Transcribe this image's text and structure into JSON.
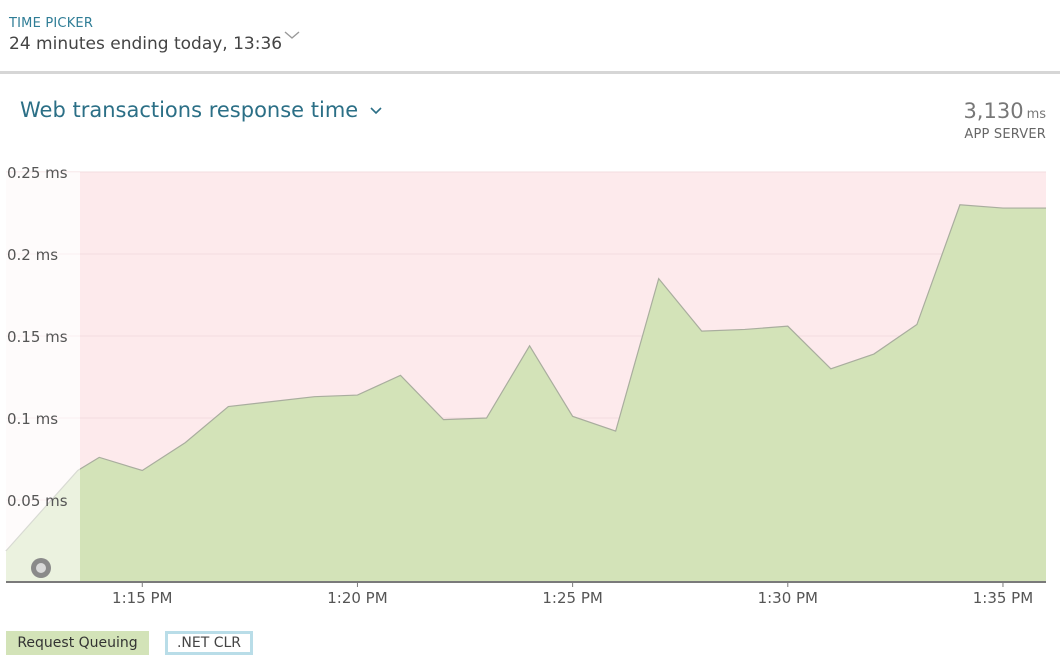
{
  "time_picker": {
    "label": "TIME PICKER",
    "value": "24 minutes ending today, 13:36",
    "chevron_icon": "chevron-down-icon"
  },
  "panel": {
    "title": "Web transactions response time",
    "title_chevron_icon": "chevron-down-icon",
    "metric_value": "3,130",
    "metric_unit": "ms",
    "metric_label": "APP SERVER"
  },
  "colors": {
    "series_fill": "#d3e3b8",
    "series_stroke": "#a9ad9e",
    "threshold_band": "#fdeaec",
    "axis": "#7a7a7a",
    "accent": "#2b6f86"
  },
  "chart_data": {
    "type": "area",
    "title": "Web transactions response time",
    "ylabel": "",
    "xlabel": "",
    "ylim": [
      0,
      0.25
    ],
    "y_ticks": [
      "0.25 ms",
      "0.2 ms",
      "0.15 ms",
      "0.1 ms",
      "0.05 ms"
    ],
    "y_tick_values": [
      0.25,
      0.2,
      0.15,
      0.1,
      0.05
    ],
    "xlim": [
      "13:11:50",
      "13:36:00"
    ],
    "x_ticks": [
      "1:15 PM",
      "1:20 PM",
      "1:25 PM",
      "1:30 PM",
      "1:35 PM"
    ],
    "x_tick_times": [
      "13:15:00",
      "13:20:00",
      "13:25:00",
      "13:30:00",
      "13:35:00"
    ],
    "grid": true,
    "legend_position": "bottom-left",
    "series": [
      {
        "name": "Request Queuing",
        "x": [
          "13:11:50",
          "13:13:30",
          "13:14:00",
          "13:15:00",
          "13:16:00",
          "13:17:00",
          "13:18:00",
          "13:19:00",
          "13:20:00",
          "13:21:00",
          "13:22:00",
          "13:23:00",
          "13:24:00",
          "13:25:00",
          "13:26:00",
          "13:27:00",
          "13:28:00",
          "13:29:00",
          "13:30:00",
          "13:31:00",
          "13:32:00",
          "13:33:00",
          "13:34:00",
          "13:35:00",
          "13:36:00"
        ],
        "values": [
          0.019,
          0.068,
          0.076,
          0.068,
          0.085,
          0.107,
          0.11,
          0.113,
          0.114,
          0.126,
          0.099,
          0.1,
          0.144,
          0.101,
          0.092,
          0.185,
          0.153,
          0.154,
          0.156,
          0.13,
          0.139,
          0.157,
          0.23,
          0.228,
          0.228
        ]
      },
      {
        "name": ".NET CLR",
        "values": []
      }
    ],
    "legend": [
      "Request Queuing",
      ".NET CLR"
    ]
  }
}
